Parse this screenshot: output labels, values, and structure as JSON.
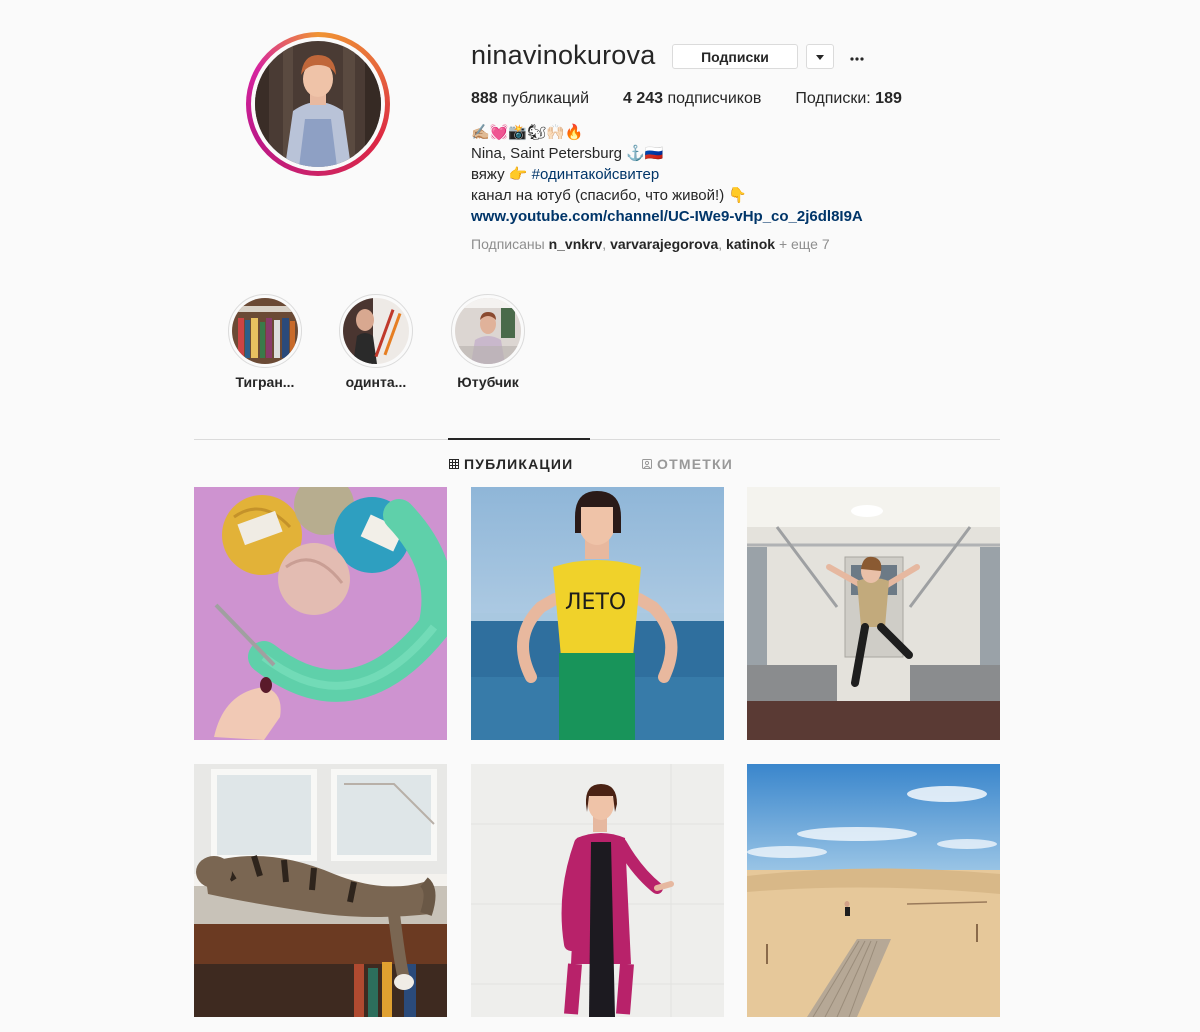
{
  "profile": {
    "username": "ninavinokurova",
    "follow_button": "Подписки",
    "stats": {
      "posts_count": "888",
      "posts_label": "публикаций",
      "followers_count": "4 243",
      "followers_label": "подписчиков",
      "following_label": "Подписки:",
      "following_count": "189"
    },
    "bio": {
      "emoji_line": "✍🏼💓📸🐿🙌🏻🔥",
      "line1": "Nina, Saint Petersburg ⚓️🇷🇺",
      "line2_prefix": "вяжу 👉",
      "line2_hashtag": "#одинтакойсвитер",
      "line3": "канал на ютуб (спасибо, что живой!)  👇",
      "link": "www.youtube.com/channel/UC-IWe9-vHp_co_2j6dl8I9A"
    },
    "followed_by": {
      "prefix": "Подписаны",
      "users": [
        "n_vnkrv",
        "varvarajegorova",
        "katinok"
      ],
      "suffix": "+ еще 7"
    }
  },
  "highlights": [
    {
      "label": "Тигран..."
    },
    {
      "label": "одинта..."
    },
    {
      "label": "Ютубчик"
    }
  ],
  "tabs": [
    {
      "label": "ПУБЛИКАЦИИ",
      "icon": "grid-icon",
      "active": true
    },
    {
      "label": "ОТМЕТКИ",
      "icon": "tagged-user-icon",
      "active": false
    }
  ],
  "posts": [
    {
      "subject": "yarn-and-knitting"
    },
    {
      "subject": "woman-yellow-top",
      "caption_on_image": "ЛЕТО"
    },
    {
      "subject": "woman-in-metro-car"
    },
    {
      "subject": "cat-on-windowsill"
    },
    {
      "subject": "woman-pink-cardigan"
    },
    {
      "subject": "sand-dunes"
    }
  ],
  "colors": {
    "text": "#262626",
    "secondary": "#8e8e8e",
    "link": "#003569",
    "border": "#dbdbdb",
    "background": "#fafafa"
  }
}
